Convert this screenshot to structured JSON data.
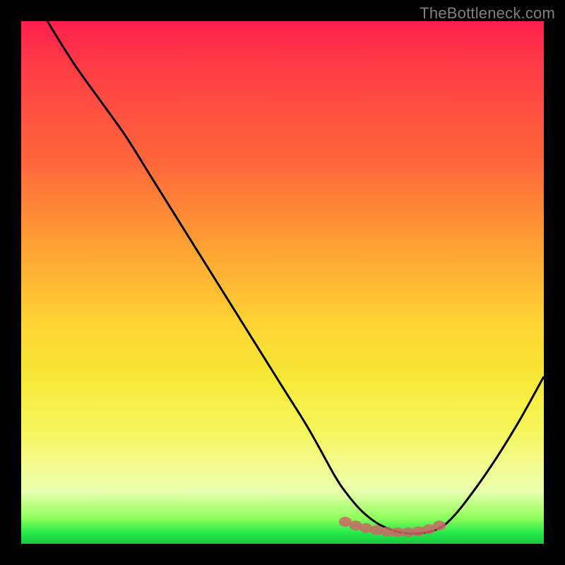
{
  "watermark": "TheBottleneck.com",
  "chart_data": {
    "type": "line",
    "title": "",
    "xlabel": "",
    "ylabel": "",
    "xlim": [
      0,
      100
    ],
    "ylim": [
      0,
      100
    ],
    "grid": false,
    "legend": false,
    "series": [
      {
        "name": "curve",
        "color": "#000000",
        "x": [
          5,
          10,
          15,
          20,
          25,
          30,
          35,
          40,
          45,
          50,
          55,
          60,
          62,
          64,
          66,
          68,
          70,
          72,
          74,
          76,
          78,
          80,
          82,
          85,
          90,
          95,
          100
        ],
        "y": [
          100,
          92,
          85,
          78,
          70,
          62,
          54,
          46,
          38,
          30,
          22,
          13,
          10,
          7.5,
          5.5,
          4.0,
          3.0,
          2.3,
          2.0,
          2.0,
          2.3,
          3.0,
          4.5,
          8,
          15,
          23,
          32
        ]
      }
    ],
    "markers": {
      "name": "bottom-dots",
      "color": "#cc6666",
      "x": [
        62,
        64,
        66,
        68,
        70,
        72,
        74,
        76,
        78,
        80
      ],
      "y": [
        4.2,
        3.5,
        3.0,
        2.6,
        2.3,
        2.2,
        2.2,
        2.4,
        2.8,
        3.5
      ]
    },
    "gradient_stops": [
      {
        "pos": 0,
        "color": "#ff1f4e"
      },
      {
        "pos": 28,
        "color": "#ff6a3a"
      },
      {
        "pos": 58,
        "color": "#ffd433"
      },
      {
        "pos": 85,
        "color": "#f3fb8f"
      },
      {
        "pos": 98,
        "color": "#23e84a"
      },
      {
        "pos": 100,
        "color": "#17c93e"
      }
    ]
  }
}
